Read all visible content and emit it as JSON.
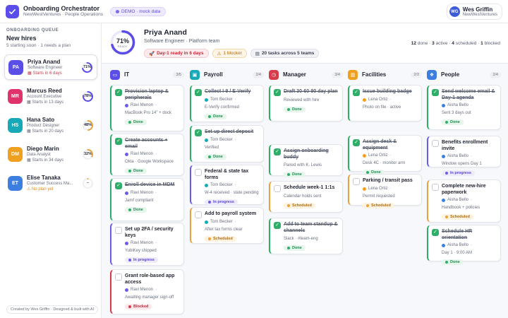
{
  "app": {
    "title": "Onboarding Orchestrator",
    "subtitle": "NewWestVentures · People Operations",
    "demo_badge": "DEMO · mock data"
  },
  "user": {
    "initials": "WG",
    "name": "Wes Griffin",
    "org": "NewWestVentures"
  },
  "sidebar": {
    "section": "ONBOARDING QUEUE",
    "title": "New hires",
    "subtitle": "5 starting soon · 1 needs a plan",
    "footer": "Created by Wes Griffin · Designed & built with AI",
    "hires": [
      {
        "initials": "PA",
        "name": "Priya Anand",
        "role": "Software Engineer",
        "start": "Starts in 6 days",
        "pct": 71,
        "pct_label": "71%",
        "color": "#5b4ee8",
        "ring": "#5b4ee8"
      },
      {
        "initials": "MR",
        "name": "Marcus Reed",
        "role": "Account Executive",
        "start": "Starts in 13 days",
        "pct": 78,
        "pct_label": "78%",
        "color": "#e0336b",
        "ring": "#5b4ee8"
      },
      {
        "initials": "HS",
        "name": "Hana Sato",
        "role": "Product Designer",
        "start": "Starts in 20 days",
        "pct": 48,
        "pct_label": "48%",
        "color": "#17a9b8",
        "ring": "#e8a23a"
      },
      {
        "initials": "DM",
        "name": "Diego Marin",
        "role": "Data Analyst",
        "start": "Starts in 34 days",
        "pct": 32,
        "pct_label": "32%",
        "color": "#f0a020",
        "ring": "#e8a23a"
      },
      {
        "initials": "ET",
        "name": "Elise Tanaka",
        "role": "Customer Success Ma...",
        "start": "No plan yet",
        "pct": 0,
        "pct_label": "–",
        "color": "#3d7fe0",
        "ring": "#e8a23a"
      }
    ]
  },
  "profile": {
    "name": "Priya Anand",
    "role": "Software Engineer · Platform team",
    "ready_pct": 71,
    "ready_value": "71%",
    "ready_label": "READY",
    "pills": {
      "day1": "Day-1 ready in 6 days",
      "blocker": "1 blocker",
      "tasks": "20 tasks across 5 teams"
    },
    "stats": {
      "done_n": "12",
      "done_l": "done",
      "active_n": "3",
      "active_l": "active",
      "sched_n": "4",
      "sched_l": "scheduled",
      "blk_n": "1",
      "blk_l": "blocked"
    }
  },
  "colors": {
    "accent": "#5b4ee8",
    "done": "#2fae68",
    "in_progress": "#6a5ce8",
    "scheduled": "#e8a23a",
    "blocked": "#d83a4a"
  },
  "columns": [
    {
      "title": "IT",
      "count": "3/5",
      "icon": "laptop-icon",
      "color": "#5b4ee8",
      "cards": [
        {
          "title": "Provision laptop & peripherals",
          "assignee": "Ravi Menon",
          "note": "MacBook Pro 14\" + dock",
          "status": "done",
          "status_label": "Done",
          "checked": true,
          "avatar": "#6a5ce8"
        },
        {
          "title": "Create accounts + email",
          "assignee": "Ravi Menon",
          "note": "Okta · Google Workspace",
          "status": "done",
          "status_label": "Done",
          "checked": true,
          "avatar": "#6a5ce8"
        },
        {
          "title": "Enroll device in MDM",
          "assignee": "Ravi Menon",
          "note": "Jamf compliant",
          "status": "done",
          "status_label": "Done",
          "checked": true,
          "avatar": "#6a5ce8"
        },
        {
          "title": "Set up 2FA / security keys",
          "assignee": "Ravi Menon",
          "note": "YubiKey shipped",
          "status": "prog",
          "status_label": "In progress",
          "checked": false,
          "avatar": "#6a5ce8"
        },
        {
          "title": "Grant role-based app access",
          "assignee": "Ravi Menon",
          "note": "Awaiting manager sign-off",
          "status": "blk",
          "status_label": "Blocked",
          "checked": false,
          "avatar": "#6a5ce8"
        }
      ]
    },
    {
      "title": "Payroll",
      "count": "2/4",
      "icon": "wallet-icon",
      "color": "#17a9b8",
      "cards": [
        {
          "title": "Collect I-9 / E-Verify",
          "assignee": "Tom Becker",
          "note": "E-Verify confirmed",
          "status": "done",
          "status_label": "Done",
          "checked": true,
          "avatar": "#17a9b8"
        },
        {
          "title": "Set up direct deposit",
          "assignee": "Tom Becker",
          "note": "Verified",
          "status": "done",
          "status_label": "Done",
          "checked": true,
          "avatar": "#17a9b8"
        },
        {
          "title": "Federal & state tax forms",
          "assignee": "Tom Becker",
          "note": "W-4 received · state pending",
          "status": "prog",
          "status_label": "In progress",
          "checked": false,
          "avatar": "#17a9b8"
        },
        {
          "title": "Add to payroll system",
          "assignee": "Tom Becker",
          "note": "After tax forms clear",
          "status": "sched",
          "status_label": "Scheduled",
          "checked": false,
          "avatar": "#17a9b8"
        }
      ]
    },
    {
      "title": "Manager",
      "count": "3/4",
      "icon": "clock-icon",
      "color": "#d83a4a",
      "cards": [
        {
          "title": "Draft 30-60-90 day plan",
          "assignee": "",
          "note": "Reviewed with hire",
          "status": "done",
          "status_label": "Done",
          "checked": true,
          "avatar": "#d83a4a"
        },
        {
          "title": "Assign onboarding buddy",
          "assignee": "",
          "note": "Paired with K. Lewis",
          "status": "done",
          "status_label": "Done",
          "checked": true,
          "avatar": "#d83a4a"
        },
        {
          "title": "Schedule week-1 1:1s",
          "assignee": "",
          "note": "Calendar holds sent",
          "status": "sched",
          "status_label": "Scheduled",
          "checked": false,
          "avatar": "#d83a4a"
        },
        {
          "title": "Add to team standup & channels",
          "assignee": "",
          "note": "Slack · #team-eng",
          "status": "done",
          "status_label": "Done",
          "checked": true,
          "avatar": "#d83a4a"
        }
      ]
    },
    {
      "title": "Facilities",
      "count": "2/3",
      "icon": "building-icon",
      "color": "#f0a020",
      "cards": [
        {
          "title": "Issue building badge",
          "assignee": "Lena Ortiz",
          "note": "Photo on file · active",
          "status": "",
          "status_label": "",
          "checked": true,
          "avatar": "#f0a020"
        },
        {
          "title": "Assign desk & equipment",
          "assignee": "Lena Ortiz",
          "note": "Desk 4C · monitor arm",
          "status": "done",
          "status_label": "Done",
          "checked": true,
          "avatar": "#f0a020"
        },
        {
          "title": "Parking / transit pass",
          "assignee": "Lena Ortiz",
          "note": "Permit requested",
          "status": "sched",
          "status_label": "Scheduled",
          "checked": false,
          "avatar": "#f0a020"
        }
      ]
    },
    {
      "title": "People",
      "count": "2/4",
      "icon": "handshake-icon",
      "color": "#3d7fe0",
      "cards": [
        {
          "title": "Send welcome email & Day-1 agenda",
          "assignee": "Aisha Bello",
          "note": "Sent 3 days out",
          "status": "done",
          "status_label": "Done",
          "checked": true,
          "avatar": "#3d7fe0"
        },
        {
          "title": "Benefits enrollment invite",
          "assignee": "Aisha Bello",
          "note": "Window opens Day 1",
          "status": "prog",
          "status_label": "In progress",
          "checked": false,
          "avatar": "#3d7fe0"
        },
        {
          "title": "Complete new-hire paperwork",
          "assignee": "Aisha Bello",
          "note": "Handbook + policies",
          "status": "sched",
          "status_label": "Scheduled",
          "checked": false,
          "avatar": "#3d7fe0"
        },
        {
          "title": "Schedule HR orientation",
          "assignee": "Aisha Bello",
          "note": "Day 1 · 9:00 AM",
          "status": "done",
          "status_label": "Done",
          "checked": true,
          "avatar": "#3d7fe0"
        }
      ]
    }
  ]
}
